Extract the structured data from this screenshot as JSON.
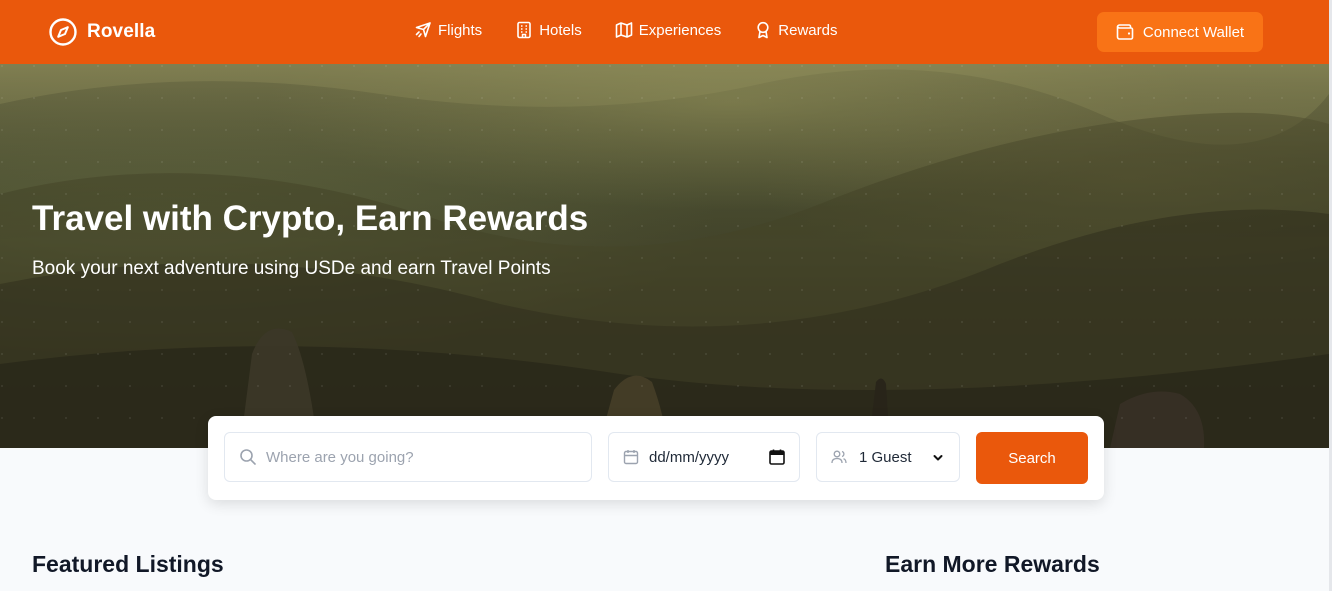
{
  "brand": {
    "name": "Rovella",
    "icon": "compass-icon"
  },
  "nav": {
    "items": [
      {
        "label": "Flights",
        "icon": "plane-icon"
      },
      {
        "label": "Hotels",
        "icon": "building-icon"
      },
      {
        "label": "Experiences",
        "icon": "map-icon"
      },
      {
        "label": "Rewards",
        "icon": "award-icon"
      }
    ],
    "wallet_label": "Connect Wallet",
    "wallet_icon": "wallet-icon"
  },
  "hero": {
    "title": "Travel with Crypto, Earn Rewards",
    "subtitle": "Book your next adventure using USDe and earn Travel Points"
  },
  "search": {
    "destination_placeholder": "Where are you going?",
    "date_value": "dd/mm/yyyy",
    "guests_value": "1 Guest",
    "button_label": "Search"
  },
  "sections": {
    "featured_title": "Featured Listings",
    "rewards_title": "Earn More Rewards"
  },
  "colors": {
    "primary": "#ea580c",
    "primary_light": "#f97316",
    "page_bg": "#f8fafc"
  }
}
